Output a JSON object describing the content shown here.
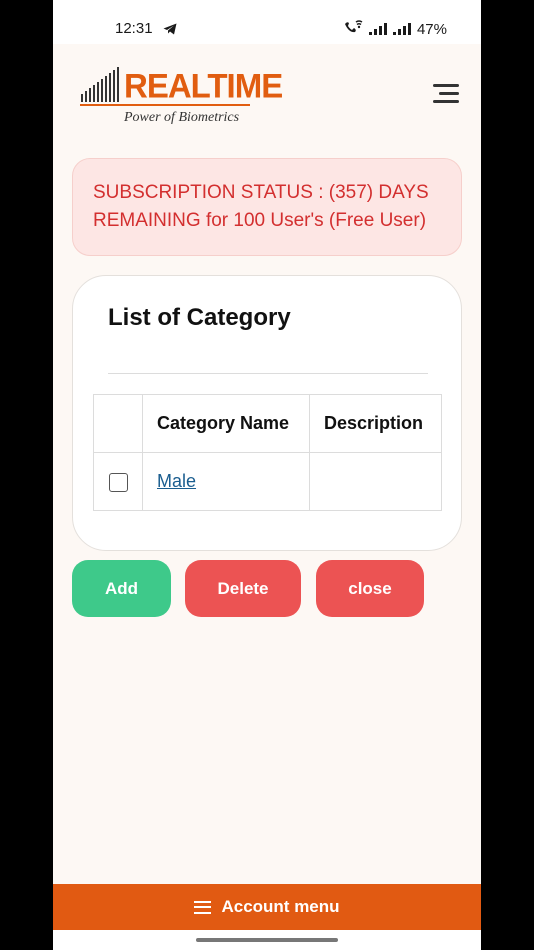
{
  "status_bar": {
    "time": "12:31",
    "battery": "47%",
    "icons": [
      "telegram-icon",
      "wifi-call-icon",
      "signal-icon",
      "signal-icon"
    ]
  },
  "header": {
    "logo_word": "Realtime",
    "logo_tagline": "Power of Biometrics",
    "menu_icon": "hamburger-menu-icon"
  },
  "subscription": {
    "text": "SUBSCRIPTION STATUS : (357) DAYS REMAINING for 100 User's (Free User)"
  },
  "category_card": {
    "title": "List of Category",
    "columns": [
      "",
      "Category Name",
      "Description"
    ],
    "rows": [
      {
        "checked": false,
        "name": "Male",
        "description": ""
      }
    ]
  },
  "actions": {
    "add": "Add",
    "delete": "Delete",
    "close": "close"
  },
  "bottom_bar": {
    "label": "Account menu",
    "icon": "hamburger-icon"
  },
  "colors": {
    "brand_orange": "#e15a12",
    "success_green": "#3ec98a",
    "danger_red": "#ec5353",
    "alert_text": "#d32f2f",
    "link_blue": "#1a5d8f"
  }
}
